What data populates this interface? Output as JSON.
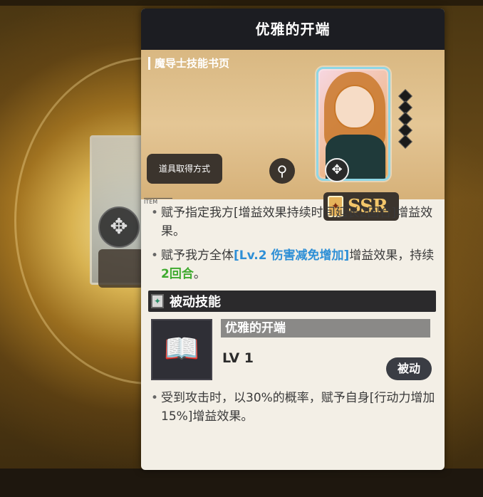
{
  "panel": {
    "title": "优雅的开端",
    "category": "魔导士技能书页",
    "obtain_button": "道具取得方式",
    "zoom_icon": "magnifier-icon",
    "rarity": "SSR",
    "item_tag": "ITEM"
  },
  "effects": {
    "line1": "赋予指定我方[增益效果持续时间延长2回合]增益效果。",
    "line2_prefix": "赋予我方全体",
    "line2_highlight": "[Lv.2 伤害减免增加]",
    "line2_mid": "增益效果，持续",
    "line2_turns": "2回合",
    "line2_suffix": "。"
  },
  "passive": {
    "section_title": "被动技能",
    "skill_name": "优雅的开端",
    "level": "LV 1",
    "type_badge": "被动",
    "description": "受到攻击时，以30%的概率，赋予自身[行动力增加15%]增益效果。"
  },
  "colors": {
    "header_bg": "#1c1d22",
    "highlight_blue": "#2e8fd6",
    "highlight_green": "#3faa2f",
    "rarity_gold": "#f3c66a"
  }
}
